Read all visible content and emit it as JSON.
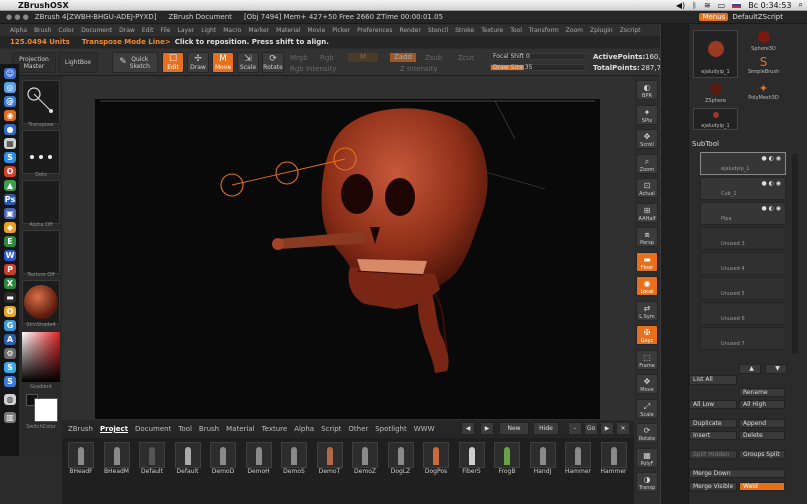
{
  "macbar": {
    "app_name": "ZBrushOSX",
    "clock": "Вс 0:34:53",
    "battery": "",
    "flag": ""
  },
  "titlebar": {
    "app_title": "ZBrush 4[ZWBH-BHGU-ADEJ-PYXD]",
    "document": "ZBrush Document",
    "stats": "[Obj 7494] Mem+ 427+50 Free 2660 ZTime 00:00:01.05",
    "menus_button": "Menus",
    "script": "DefaultZScript"
  },
  "menubar": [
    "Alpha",
    "Brush",
    "Color",
    "Document",
    "Draw",
    "Edit",
    "File",
    "Layer",
    "Light",
    "Macro",
    "Marker",
    "Material",
    "Movie",
    "Picker",
    "Preferences",
    "Render",
    "Stencil",
    "Stroke",
    "Texture",
    "Tool",
    "Transform",
    "Zoom",
    "Zplugin",
    "Zscript"
  ],
  "statusline": {
    "units": "125.0494 Units",
    "mode": "Transpose Mode Line>",
    "hint": "Click to reposition. Press shift to align."
  },
  "toolbar": {
    "projection_master": "Projection Master",
    "lightbox": "LightBox",
    "quick_sketch": "Quick Sketch",
    "edit": "Edit",
    "draw": "Draw",
    "move": "Move",
    "scale": "Scale",
    "rotate": "Rotate",
    "mrgb": "Mrgb",
    "rgb": "Rgb",
    "m": "M",
    "zadd": "Zadd",
    "zsub": "Zsub",
    "zcut": "Zcut",
    "rgb_intensity": "Rgb Intensity",
    "z_intensity": "Z Intensity",
    "focal_shift_label": "Focal Shift",
    "focal_shift_value": "0",
    "draw_size_label": "Draw Size",
    "draw_size_value": "35",
    "draw_size_fraction": 0.35,
    "active_points_label": "ActivePoints:",
    "active_points_value": "160,",
    "total_points_label": "TotalPoints:",
    "total_points_value": "287,7"
  },
  "leftshelf": {
    "transpose": "Transpose",
    "dots": "Dots",
    "alpha_off": "Alpha Off",
    "texture_off": "Texture Off",
    "material": "SkinShade4",
    "gradient": "Gradient",
    "switch_color": "SwitchColor"
  },
  "rightstrip": [
    "BPR",
    "SPix",
    "Scroll",
    "Zoom",
    "Actual",
    "AAHalf",
    "Persp",
    "Floor",
    "Local",
    "L.Sym",
    "Gxyz",
    "Frame",
    "Move",
    "Scale",
    "Rotate",
    "PolyF",
    "Transp"
  ],
  "tray": {
    "tools": [
      {
        "label": "ejaludyip_1"
      },
      {
        "label": "Sphere3D"
      },
      {
        "label": "SimpleBrush"
      },
      {
        "label": "ZSphere"
      },
      {
        "label": "PolyMesh3D"
      },
      {
        "label": "ejaludyip_1"
      }
    ],
    "subtool_title": "SubTool",
    "subtools": [
      {
        "name": "ejaludyip_1"
      },
      {
        "name": "Cub_1"
      },
      {
        "name": "Pipa"
      },
      {
        "name": "Unused 3"
      },
      {
        "name": "Unused 4"
      },
      {
        "name": "Unused 5"
      },
      {
        "name": "Unused 6"
      },
      {
        "name": "Unused 7"
      }
    ],
    "buttons": {
      "list_all": "List All",
      "rename": "Rename",
      "all_low": "All Low",
      "all_high": "All High",
      "duplicate": "Duplicate",
      "append": "Append",
      "insert": "Insert",
      "delete": "Delete",
      "split_hidden": "Split Hidden",
      "groups_split": "Groups Split",
      "merge_down": "Merge Down",
      "merge_visible": "Merge Visible",
      "weld": "Weld"
    }
  },
  "bottom": {
    "tabs": [
      "ZBrush",
      "Project",
      "Document",
      "Tool",
      "Brush",
      "Material",
      "Texture",
      "Alpha",
      "Script",
      "Other",
      "Spotlight",
      "WWW"
    ],
    "new": "New",
    "hide": "Hide",
    "go": "Go",
    "thumbs": [
      "BHeadF",
      "BHeadM",
      "Default",
      "Default",
      "DemoD",
      "DemoH",
      "DemoS",
      "DemoT",
      "DemoZ",
      "DogLZ",
      "DogPos",
      "FiberS",
      "FrogB",
      "HandJ",
      "Hammer",
      "Hammer"
    ]
  },
  "colors": {
    "accent": "#e8701a",
    "clay": "#9b3a22",
    "background": "#2b2b2b"
  }
}
